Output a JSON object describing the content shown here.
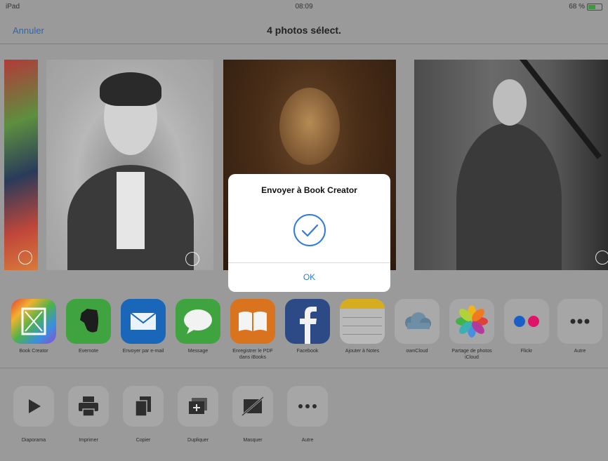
{
  "status": {
    "device": "iPad",
    "time": "08:09",
    "battery": "68 %"
  },
  "nav": {
    "cancel": "Annuler",
    "title": "4 photos sélect."
  },
  "share_apps": [
    {
      "label": "Book Creator",
      "icon": "book-creator-icon"
    },
    {
      "label": "Evernote",
      "icon": "evernote-icon"
    },
    {
      "label": "Envoyer par e-mail",
      "icon": "mail-icon"
    },
    {
      "label": "Message",
      "icon": "message-icon"
    },
    {
      "label": "Enregistrer le PDF dans iBooks",
      "icon": "ibooks-icon"
    },
    {
      "label": "Facebook",
      "icon": "facebook-icon"
    },
    {
      "label": "Ajouter à Notes",
      "icon": "notes-icon"
    },
    {
      "label": "ownCloud",
      "icon": "owncloud-icon"
    },
    {
      "label": "Partage de photos iCloud",
      "icon": "photos-icon"
    },
    {
      "label": "Flickr",
      "icon": "flickr-icon"
    },
    {
      "label": "Autre",
      "icon": "more-icon"
    }
  ],
  "actions": [
    {
      "label": "Diaporama",
      "icon": "play-icon"
    },
    {
      "label": "Imprimer",
      "icon": "printer-icon"
    },
    {
      "label": "Copier",
      "icon": "copy-icon"
    },
    {
      "label": "Dupliquer",
      "icon": "duplicate-icon"
    },
    {
      "label": "Masquer",
      "icon": "hide-icon"
    },
    {
      "label": "Autre",
      "icon": "more-icon"
    }
  ],
  "dialog": {
    "title": "Envoyer à Book Creator",
    "ok": "OK"
  },
  "colors": {
    "accent": "#2f7be0",
    "dim_background": "#9a9a9a"
  }
}
